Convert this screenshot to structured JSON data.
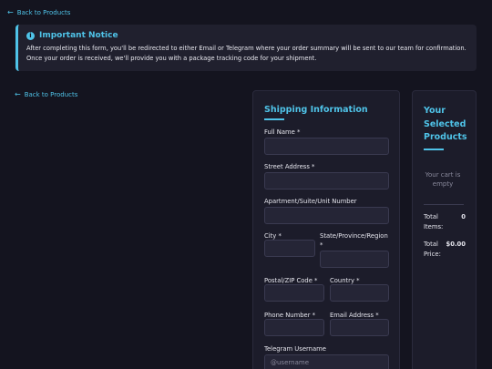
{
  "nav": {
    "back_label": "Back to Products"
  },
  "notice": {
    "title": "Important Notice",
    "text": "After completing this form, you'll be redirected to either Email or Telegram where your order summary will be sent to our team for confirmation. Once your order is received, we'll provide you with a package tracking code for your shipment."
  },
  "form": {
    "title": "Shipping Information",
    "fields": {
      "full_name": {
        "label": "Full Name *",
        "value": ""
      },
      "street": {
        "label": "Street Address *",
        "value": ""
      },
      "apartment": {
        "label": "Apartment/Suite/Unit Number",
        "value": ""
      },
      "city": {
        "label": "City *",
        "value": ""
      },
      "state": {
        "label": "State/Province/Region *",
        "value": ""
      },
      "postal": {
        "label": "Postal/ZIP Code *",
        "value": ""
      },
      "country": {
        "label": "Country *",
        "value": ""
      },
      "phone": {
        "label": "Phone Number *",
        "value": ""
      },
      "email": {
        "label": "Email Address *",
        "value": ""
      },
      "telegram": {
        "label": "Telegram Username",
        "placeholder": "@username"
      }
    }
  },
  "cart": {
    "title": "Your Selected Products",
    "empty_text": "Your cart is empty",
    "total_items_label": "Total Items:",
    "total_items_value": "0",
    "total_price_label": "Total Price:",
    "total_price_value": "$0.00"
  },
  "colors": {
    "accent": "#4fc3e8",
    "background": "#14141f",
    "card": "#1c1c2a"
  }
}
